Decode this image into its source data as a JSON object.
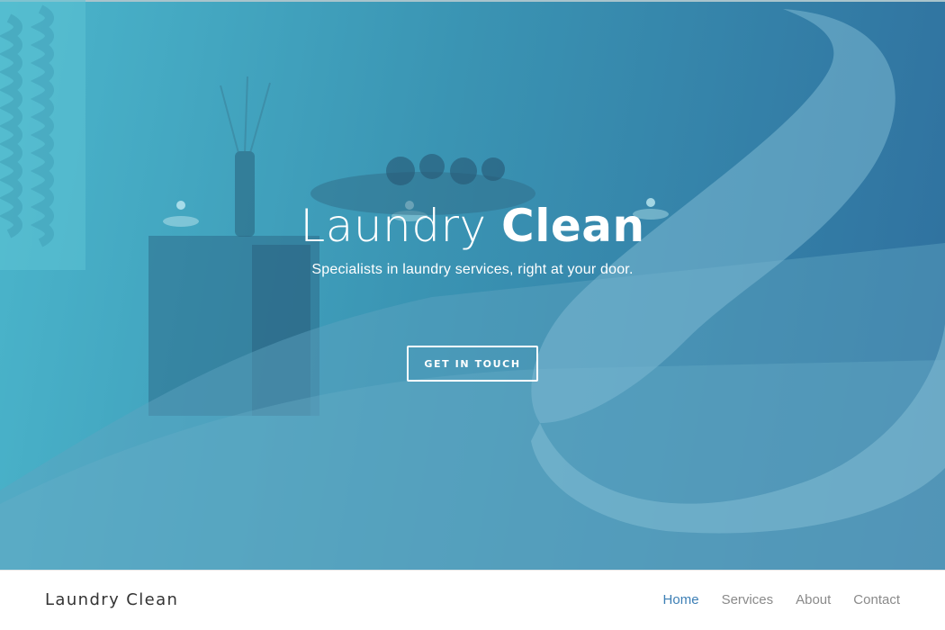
{
  "hero": {
    "title_light": "Laundry",
    "title_bold": "Clean",
    "subtitle": "Specialists in laundry services, right at your door.",
    "cta_label": "GET IN TOUCH",
    "gradient": [
      "#4bb6cc",
      "#3a94b3",
      "#2f6f9e"
    ]
  },
  "navbar": {
    "brand": "Laundry Clean",
    "items": [
      {
        "label": "Home",
        "active": true
      },
      {
        "label": "Services",
        "active": false
      },
      {
        "label": "About",
        "active": false
      },
      {
        "label": "Contact",
        "active": false
      }
    ],
    "active_color": "#3d7fb5",
    "inactive_color": "#8a8a8a"
  }
}
